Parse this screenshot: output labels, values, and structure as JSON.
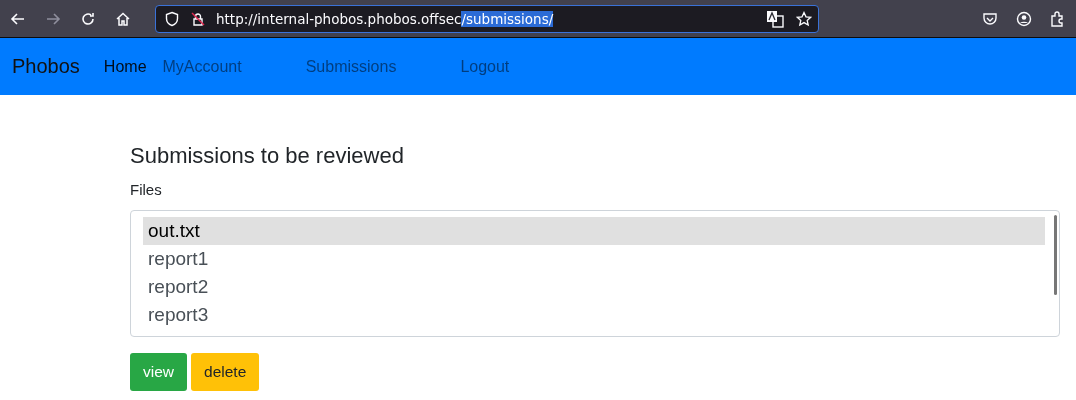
{
  "browser": {
    "address": "http://internal-phobos.phobos.offsec",
    "address_selected": "/submissions/"
  },
  "navbar": {
    "brand": "Phobos",
    "items": [
      {
        "label": "Home",
        "selected": true
      },
      {
        "label": "MyAccount",
        "selected": false
      },
      {
        "label": "Submissions",
        "selected": false
      },
      {
        "label": "Logout",
        "selected": false
      }
    ]
  },
  "heading": "Submissions to be reviewed",
  "files": {
    "label": "Files",
    "options": [
      {
        "label": "out.txt",
        "selected": true
      },
      {
        "label": "report1",
        "selected": false
      },
      {
        "label": "report2",
        "selected": false
      },
      {
        "label": "report3",
        "selected": false
      }
    ]
  },
  "buttons": [
    {
      "label": "view",
      "kind": "success"
    },
    {
      "label": "delete",
      "kind": "warning"
    }
  ]
}
